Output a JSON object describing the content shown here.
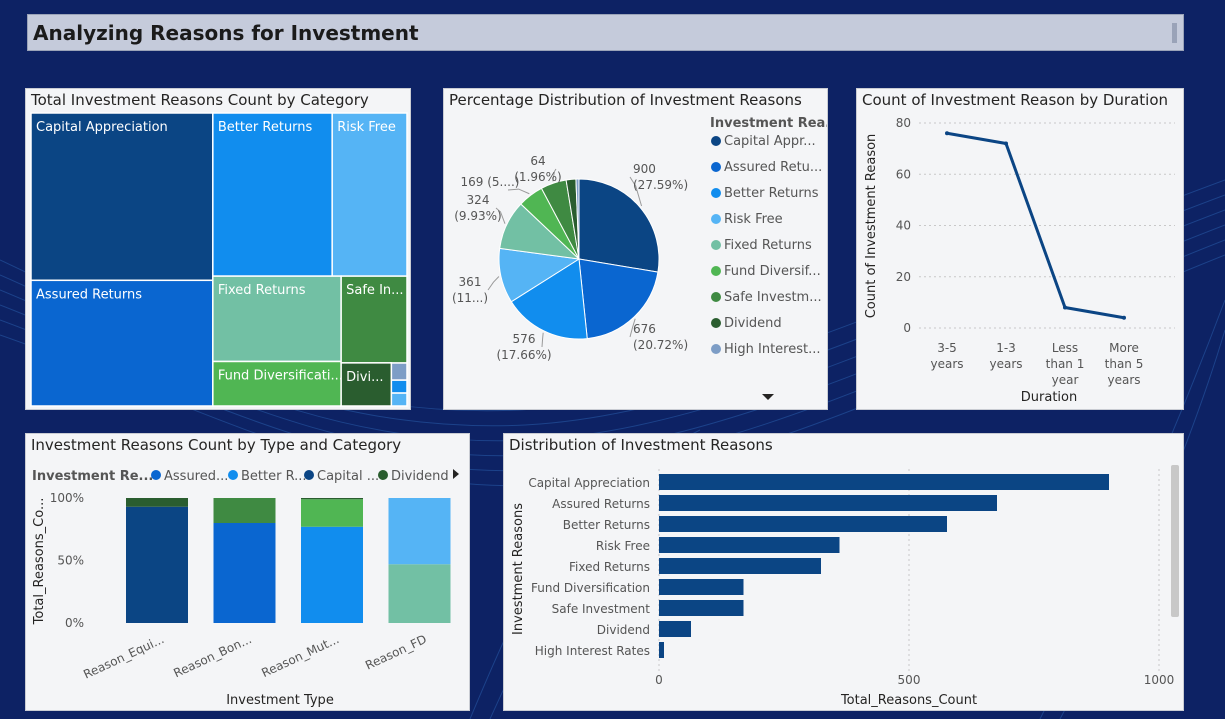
{
  "header": {
    "title": "Analyzing Reasons for Investment"
  },
  "colors": {
    "capital_appreciation": "#0b4584",
    "assured_returns": "#0a66d0",
    "better_returns": "#118dee",
    "risk_free": "#55b4f5",
    "fixed_returns": "#72c0a4",
    "fund_diversification": "#50b653",
    "safe_investment": "#3f8a42",
    "dividend": "#2a5d2f",
    "high_interest_rates": "#7d9dc6"
  },
  "chart_data": [
    {
      "type": "treemap",
      "title": "Total Investment Reasons Count by Category",
      "categories": [
        "Capital Appreciation",
        "Assured Returns",
        "Better Returns",
        "Risk Free",
        "Fixed Returns",
        "Safe In...",
        "Fund Diversificati...",
        "Divi..."
      ],
      "values": [
        900,
        676,
        576,
        361,
        324,
        169,
        169,
        64
      ]
    },
    {
      "type": "pie",
      "title": "Percentage Distribution of Investment Reasons",
      "legend_title": "Investment Rea...",
      "legend_position": "right",
      "legend": [
        "Capital Appr...",
        "Assured Retu...",
        "Better Returns",
        "Risk Free",
        "Fixed Returns",
        "Fund Diversif...",
        "Safe Investm...",
        "Dividend",
        "High Interest..."
      ],
      "values": [
        900,
        676,
        576,
        361,
        324,
        169,
        169,
        64,
        20
      ],
      "data_labels": [
        {
          "value": "900",
          "pct": "(27.59%)"
        },
        {
          "value": "676",
          "pct": "(20.72%)"
        },
        {
          "value": "576",
          "pct": "(17.66%)"
        },
        {
          "value": "361",
          "pct": "(11...)"
        },
        {
          "value": "324",
          "pct": "(9.93%)"
        },
        {
          "value": "169 (5....)",
          "pct": ""
        },
        {
          "value": "64",
          "pct": "(1.96%)"
        }
      ]
    },
    {
      "type": "line",
      "title": "Count of Investment Reason by Duration",
      "xlabel": "Duration",
      "ylabel": "Count of Investment Reason",
      "x": [
        [
          "3-5",
          "years"
        ],
        [
          "1-3",
          "years"
        ],
        [
          "Less",
          "than 1",
          "year"
        ],
        [
          "More",
          "than 5",
          "years"
        ]
      ],
      "values": [
        76,
        72,
        8,
        4
      ],
      "ylim": [
        0,
        80
      ],
      "yticks": [
        "0",
        "20",
        "40",
        "60",
        "80"
      ],
      "grid": true
    },
    {
      "type": "stacked_bar_100",
      "title": "Investment Reasons Count by Type and Category",
      "legend_title": "Investment Re...",
      "legend_position": "top",
      "legend": [
        "Assured...",
        "Better R...",
        "Capital ...",
        "Dividend"
      ],
      "xlabel": "Investment Type",
      "ylabel": "Total_Reasons_Co...",
      "categories": [
        "Reason_Equi...",
        "Reason_Bon...",
        "Reason_Mut...",
        "Reason_FD"
      ],
      "yticks": [
        "0%",
        "50%",
        "100%"
      ],
      "series": [
        {
          "key": "capital_appreciation",
          "values": [
            93,
            0,
            0,
            0
          ]
        },
        {
          "key": "assured_returns",
          "values": [
            0,
            80,
            0,
            0
          ]
        },
        {
          "key": "better_returns",
          "values": [
            0,
            0,
            77,
            0
          ]
        },
        {
          "key": "fixed_returns",
          "values": [
            0,
            0,
            0,
            47
          ]
        },
        {
          "key": "risk_free",
          "values": [
            0,
            0,
            0,
            53
          ]
        },
        {
          "key": "fund_diversification",
          "values": [
            0,
            0,
            22,
            0
          ]
        },
        {
          "key": "safe_investment",
          "values": [
            0,
            20,
            0,
            0
          ]
        },
        {
          "key": "dividend",
          "values": [
            7,
            0,
            1,
            0
          ]
        }
      ]
    },
    {
      "type": "bar_horizontal",
      "title": "Distribution of Investment Reasons",
      "xlabel": "Total_Reasons_Count",
      "ylabel": "Investment Reasons",
      "categories": [
        "Capital Appreciation",
        "Assured Returns",
        "Better Returns",
        "Risk Free",
        "Fixed Returns",
        "Fund Diversification",
        "Safe Investment",
        "Dividend",
        "High Interest Rates"
      ],
      "values": [
        900,
        676,
        576,
        361,
        324,
        169,
        169,
        64,
        10
      ],
      "xlim": [
        0,
        1000
      ],
      "xticks": [
        "0",
        "500",
        "1000"
      ],
      "bar_color": "#0b4584"
    }
  ]
}
